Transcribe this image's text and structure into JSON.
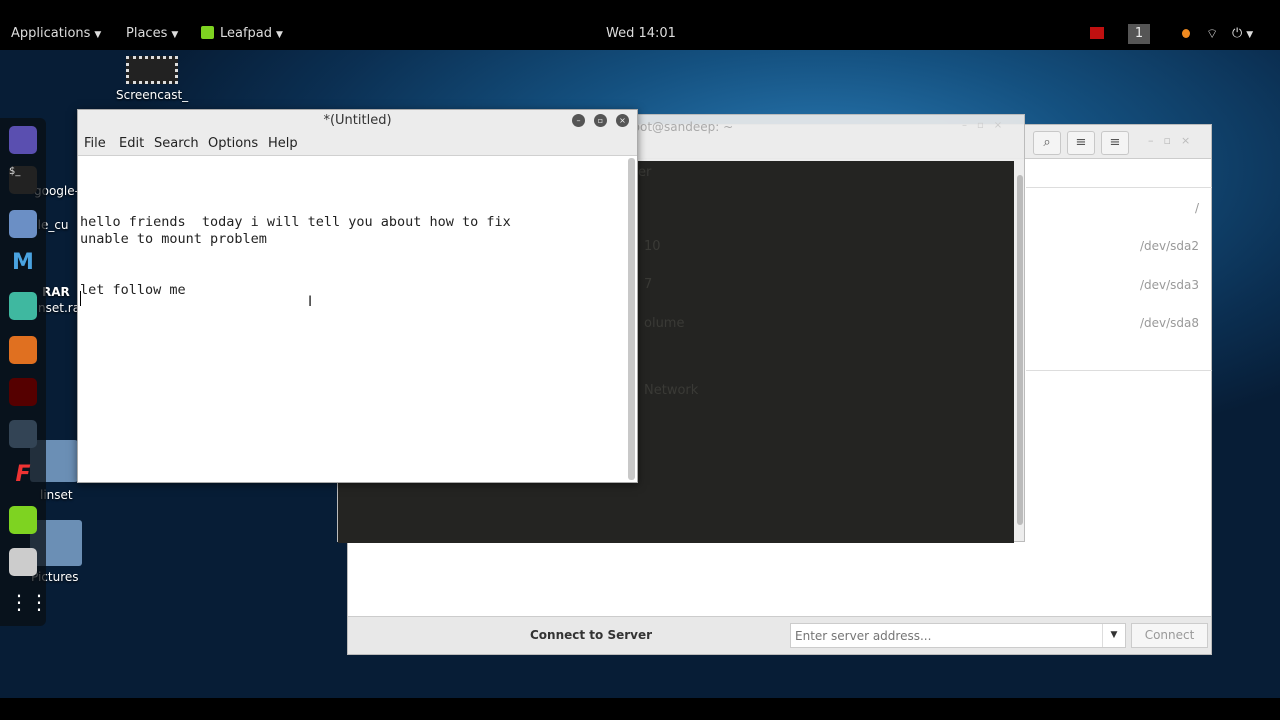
{
  "panel": {
    "applications": "Applications",
    "places": "Places",
    "app": "Leafpad",
    "clock": "Wed 14:01",
    "workspace": "1"
  },
  "desktop": {
    "icons": [
      {
        "label": "Screencast_"
      },
      {
        "label": "google-chrome"
      },
      {
        "label": "ple_cu"
      },
      {
        "label": "RAR"
      },
      {
        "label": "nset.ra"
      },
      {
        "label": "linset"
      },
      {
        "label": "Pictures"
      }
    ]
  },
  "dock": {
    "items": [
      "pidgin-icon",
      "terminal-icon",
      "files-icon",
      "metasploit-icon",
      "avatar-app-icon",
      "burpsuite-icon",
      "armitage-icon",
      "maltego-icon",
      "faraday-icon",
      "leafpad-icon",
      "settings-icon",
      "show-apps-icon"
    ]
  },
  "file_manager": {
    "devices": [
      "/",
      "/dev/sda2",
      "/dev/sda3",
      "/dev/sda8"
    ],
    "connect_label": "Connect to Server",
    "server_placeholder": "Enter server address...",
    "connect_button": "Connect"
  },
  "terminal": {
    "title": "root@sandeep: ~",
    "ghost": [
      "er",
      "10",
      "7",
      "olume",
      "Network"
    ]
  },
  "leafpad": {
    "title": "*(Untitled)",
    "menu": [
      "File",
      "Edit",
      "Search",
      "Options",
      "Help"
    ],
    "text": "\n\nhello friends  today i will tell you about how to fix\nunable to mount problem\n\n\nlet follow me\n"
  },
  "colors": {
    "desktop": "#14507f",
    "terminal_bg": "#242422",
    "leafpad_icon": "#7ed321"
  }
}
